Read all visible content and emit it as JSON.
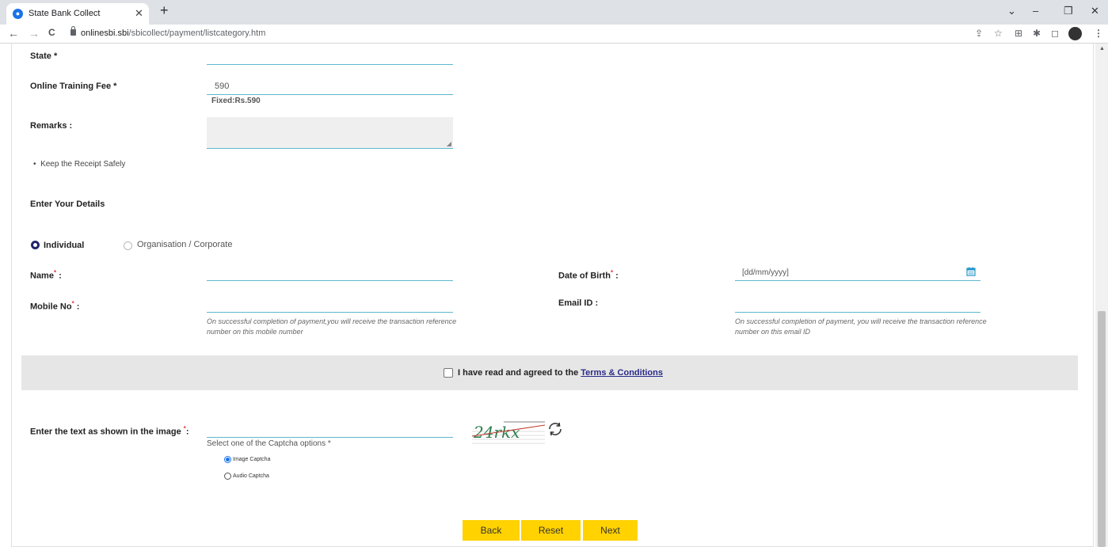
{
  "browser": {
    "tab_title": "State Bank Collect",
    "tab_close": "✕",
    "new_tab": "+",
    "url_host": "onlinesbi.sbi",
    "url_path": "/sbicollect/payment/listcategory.htm",
    "window_controls": {
      "dropdown": "⌄",
      "minimize": "–",
      "restore": "❐",
      "close": "✕"
    },
    "nav": {
      "back": "←",
      "forward": "→",
      "reload": "C"
    }
  },
  "form": {
    "state": {
      "label": "State",
      "required_mark": "*",
      "value": ""
    },
    "fee": {
      "label": "Online Training Fee",
      "required_mark": "*",
      "value": "590",
      "note": "Fixed:Rs.590"
    },
    "remarks": {
      "label": "Remarks :",
      "value": ""
    },
    "bullet_note": "Keep the Receipt Safely",
    "details_heading": "Enter Your Details",
    "type_options": [
      {
        "label": "Individual",
        "selected": true
      },
      {
        "label": "Organisation / Corporate",
        "selected": false
      }
    ],
    "name": {
      "label": "Name",
      "required_mark": "*",
      "colon": " :",
      "value": ""
    },
    "dob": {
      "label": "Date of Birth",
      "required_mark": "*",
      "colon": " :",
      "placeholder": "[dd/mm/yyyy]"
    },
    "mobile": {
      "label": "Mobile No",
      "required_mark": "*",
      "colon": " :",
      "value": "",
      "hint_line1": "On successful completion of payment,you will receive the transaction reference",
      "hint_line2": "number on this mobile number"
    },
    "email": {
      "label": "Email ID :",
      "value": "",
      "hint_line1": "On successful completion of payment, you will receive the transaction reference",
      "hint_line2": "number on this email ID"
    },
    "terms": {
      "text": "I have read and agreed to the",
      "link": "Terms & Conditions",
      "checked": false
    },
    "captcha": {
      "label": "Enter the text as shown in the image",
      "required_mark": "*",
      "colon": ":",
      "value": "",
      "options_heading": "Select one of the Captcha options *",
      "options": [
        {
          "label": "Image Captcha",
          "selected": true
        },
        {
          "label": "Audio Captcha",
          "selected": false
        }
      ],
      "image_text": "24rkx"
    },
    "buttons": {
      "back": "Back",
      "reset": "Reset",
      "next": "Next"
    }
  },
  "colors": {
    "accent_line": "#5fb7cf",
    "button": "#ffd200",
    "radio_selected": "#22246b",
    "required": "#e53935"
  },
  "icons": [
    "calendar-icon",
    "refresh-icon",
    "lock-icon",
    "share-icon",
    "star-icon",
    "extension-icon",
    "puzzle-icon",
    "sidepanel-icon",
    "profile-avatar",
    "menu-icon"
  ]
}
